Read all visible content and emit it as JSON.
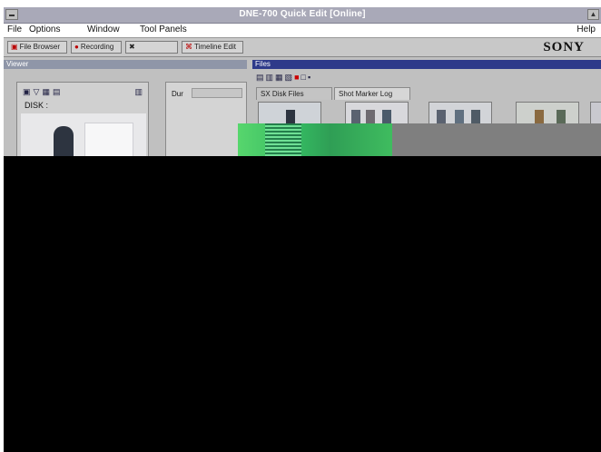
{
  "window": {
    "title": "DNE-700 Quick Edit [Online]"
  },
  "menu": {
    "items": [
      "File",
      "Options",
      "Window",
      "Tool Panels"
    ],
    "help": "Help"
  },
  "toolbar": {
    "file_browser": "File Browser",
    "recording": "Recording",
    "disabled_label": "",
    "timeline_edit": "Timeline Edit",
    "brand": "SONY"
  },
  "viewer": {
    "title": "Viewer",
    "disk_label": "DISK :",
    "dur_label": "Dur"
  },
  "files": {
    "title": "Files",
    "tabs": [
      "SX Disk Files",
      "Shot Marker Log"
    ]
  }
}
